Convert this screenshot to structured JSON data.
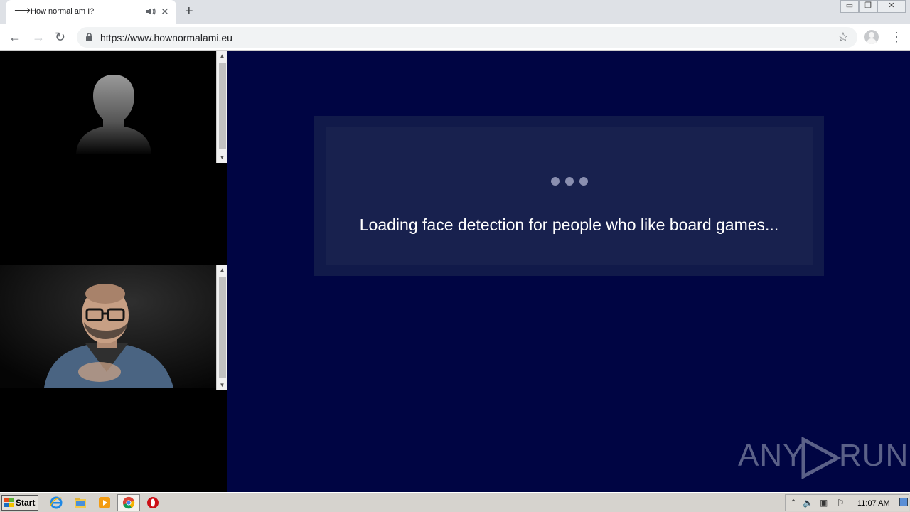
{
  "browser": {
    "tab_title": "How normal am I?",
    "new_tab_label": "+",
    "url": "https://www.hownormalami.eu",
    "window_controls": [
      "minimize",
      "restore",
      "close"
    ]
  },
  "page": {
    "loading_text": "Loading face detection for people who like board games...",
    "watermark": {
      "left": "ANY",
      "right": "RUN"
    },
    "colors": {
      "main_bg": "#000543",
      "card_bg": "#111a4a",
      "card_inner": "#18214e",
      "dot": "#8a8fb0"
    }
  },
  "taskbar": {
    "start_label": "Start",
    "clock": "11:07 AM",
    "apps": [
      "ie-icon",
      "explorer-icon",
      "media-player-icon",
      "chrome-icon",
      "opera-icon"
    ]
  }
}
